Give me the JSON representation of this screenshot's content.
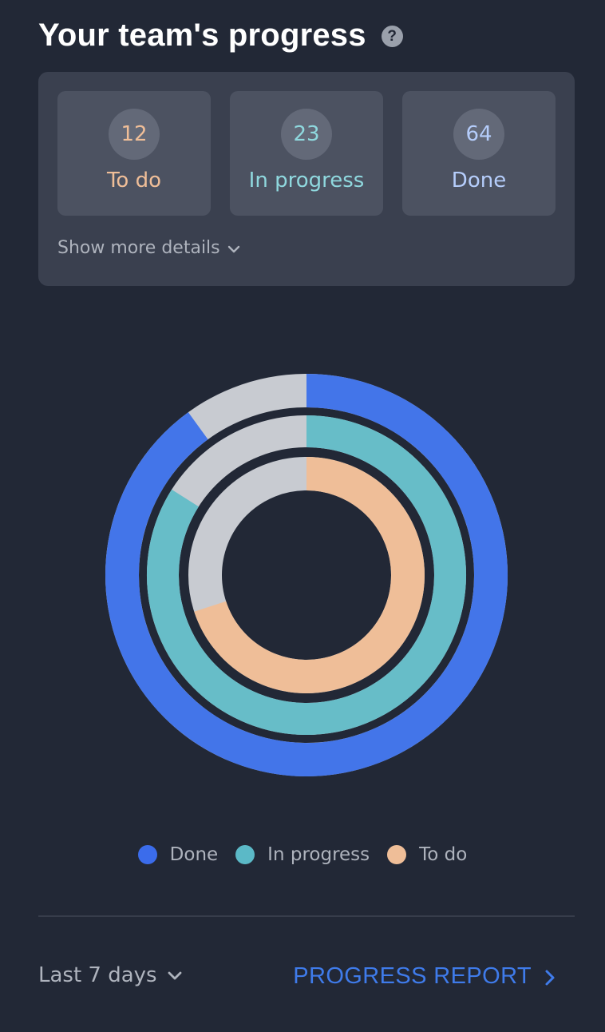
{
  "header": {
    "title": "Your team's progress",
    "help_icon": "question-circle-icon"
  },
  "summary": {
    "cards": [
      {
        "count": "12",
        "label": "To do",
        "color": "#EFBE98"
      },
      {
        "count": "23",
        "label": "In progress",
        "color": "#8FD8DE"
      },
      {
        "count": "64",
        "label": "Done",
        "color": "#B5CDFB"
      }
    ],
    "show_more_label": "Show more details",
    "show_more_icon": "chevron-down-icon"
  },
  "chart_data": {
    "type": "radial-progress",
    "track_color": "#C8CBD1",
    "series": [
      {
        "name": "Done",
        "fraction": 0.9,
        "color": "#4375E9"
      },
      {
        "name": "In progress",
        "fraction": 0.84,
        "color": "#67BDC8"
      },
      {
        "name": "To do",
        "fraction": 0.7,
        "color": "#EFBE98"
      }
    ]
  },
  "legend": [
    {
      "label": "Done",
      "color": "#3B6CEB"
    },
    {
      "label": "In progress",
      "color": "#5BB9C7"
    },
    {
      "label": "To do",
      "color": "#EFBE98"
    }
  ],
  "footer": {
    "range_label": "Last 7 days",
    "range_icon": "chevron-down-icon",
    "report_label": "PROGRESS REPORT",
    "report_icon": "chevron-right-icon",
    "link_color": "#3F7BEA"
  }
}
